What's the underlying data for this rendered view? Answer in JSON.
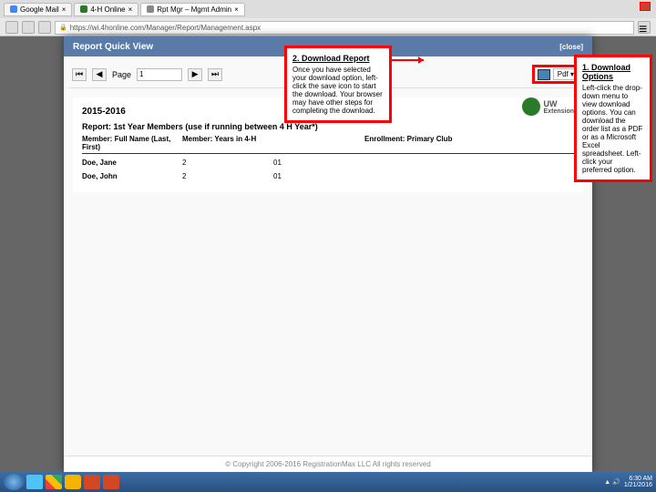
{
  "browser": {
    "tabs": [
      "Google Mail",
      "4-H Online",
      "Rpt Mgr – Mgmt Admin"
    ],
    "url": "https://wi.4honline.com/Manager/Report/Management.aspx"
  },
  "modal": {
    "title": "Report Quick View",
    "close": "[close]"
  },
  "toolbar": {
    "page_label": "Page",
    "page_value": "1",
    "format": "Pdf"
  },
  "report": {
    "year": "2015-2016",
    "title": "Report: 1st Year Members (use if running between 4 H Year*)",
    "col1": "Member: Full Name (Last, First)",
    "col2": "Member: Years in 4-H",
    "col3": "",
    "col4": "Enrollment: Primary Club",
    "ext_label": "Extension",
    "rows": [
      {
        "name": "Doe, Jane",
        "years": "2",
        "c3": "01",
        "club": ""
      },
      {
        "name": "Doe, John",
        "years": "2",
        "c3": "01",
        "club": ""
      }
    ]
  },
  "footer": {
    "copy": "© Copyright 2006-2016 RegistrationMax LLC All rights reserved"
  },
  "callouts": {
    "c2_title": "2. Download Report",
    "c2_body": "Once you have selected your download option, left-click the save icon to start the download. Your browser may have other steps for completing the download.",
    "c1_title": "1. Download Options",
    "c1_body": "Left-click the drop-down menu to view download options. You can download the order list as a PDF or as a Microsoft Excel spreadsheet. Left-click your preferred option."
  },
  "tray": {
    "time": "6:30 AM",
    "date": "1/21/2016"
  }
}
